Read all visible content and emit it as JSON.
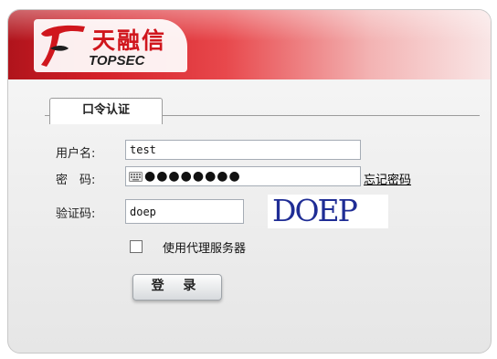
{
  "header": {
    "logo_cn": "天融信",
    "logo_en": "TOPSEC",
    "brand_color": "#d0161d"
  },
  "tabs": [
    {
      "label": "口令认证",
      "active": true
    }
  ],
  "form": {
    "username": {
      "label": "用户名:",
      "value": "test"
    },
    "password": {
      "label": "密　码:",
      "masked_value": "●●●●●●●●",
      "keyboard_icon": "keyboard-icon"
    },
    "forgot_link": "忘记密码",
    "captcha": {
      "label": "验证码:",
      "value": "doep",
      "image_text": "DOEP",
      "image_color": "#1f2d95"
    },
    "proxy_checkbox": {
      "label": "使用代理服务器",
      "checked": false
    },
    "login_button": "登 录"
  }
}
